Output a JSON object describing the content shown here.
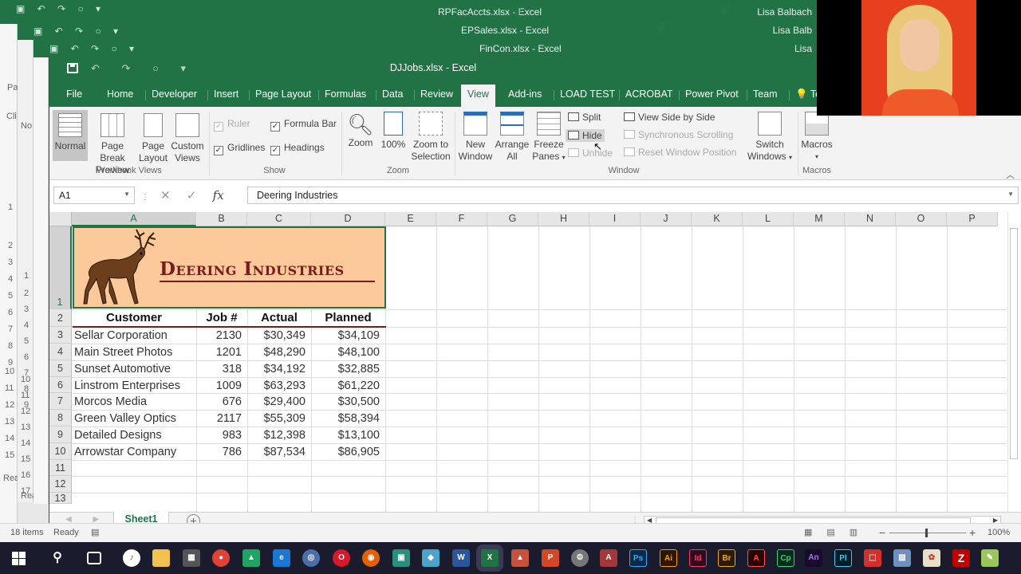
{
  "bg_windows": [
    {
      "title": "RPFacAccts.xlsx - Excel",
      "user": "Lisa Balbach"
    },
    {
      "title": "EPSales.xlsx - Excel",
      "user": "Lisa Balb"
    },
    {
      "title": "FinCon.xlsx - Excel",
      "user": "Lisa"
    }
  ],
  "slivers": {
    "a": [
      "Pa",
      "Cli",
      "1",
      "2",
      "3",
      "4",
      "5",
      "6",
      "7",
      "8",
      "9",
      "10",
      "11",
      "12",
      "13",
      "14",
      "15",
      "Rea"
    ],
    "b": [
      "No",
      "1",
      "2",
      "3",
      "4",
      "5",
      "6",
      "7",
      "8",
      "9",
      "10",
      "11",
      "12",
      "13",
      "14",
      "15",
      "16",
      "17",
      "Rea"
    ]
  },
  "window": {
    "title": "DJJobs.xlsx - Excel"
  },
  "tabs": [
    "File",
    "Home",
    "Developer",
    "Insert",
    "Page Layout",
    "Formulas",
    "Data",
    "Review",
    "View",
    "Add-ins",
    "LOAD TEST",
    "ACROBAT",
    "Power Pivot",
    "Team",
    "Te"
  ],
  "active_tab": "View",
  "ribbon": {
    "workbook_views": {
      "label": "Workbook Views",
      "normal": "Normal",
      "page_break_1": "Page Break",
      "page_break_2": "Preview",
      "page_layout_1": "Page",
      "page_layout_2": "Layout",
      "custom_1": "Custom",
      "custom_2": "Views"
    },
    "show": {
      "label": "Show",
      "ruler": "Ruler",
      "formula_bar": "Formula Bar",
      "gridlines": "Gridlines",
      "headings": "Headings"
    },
    "zoom": {
      "label": "Zoom",
      "zoom": "Zoom",
      "pct": "100%",
      "zts_1": "Zoom to",
      "zts_2": "Selection"
    },
    "window": {
      "label": "Window",
      "new_1": "New",
      "new_2": "Window",
      "arrange_1": "Arrange",
      "arrange_2": "All",
      "freeze_1": "Freeze",
      "freeze_2": "Panes",
      "split": "Split",
      "hide": "Hide",
      "unhide": "Unhide",
      "side_by_side": "View Side by Side",
      "sync": "Synchronous Scrolling",
      "reset": "Reset Window Position",
      "switch_1": "Switch",
      "switch_2": "Windows"
    },
    "macros": {
      "label": "Macros",
      "btn": "Macros"
    }
  },
  "formula_bar": {
    "namebox": "A1",
    "content": "Deering Industries"
  },
  "columns": [
    "A",
    "B",
    "C",
    "D",
    "E",
    "F",
    "G",
    "H",
    "I",
    "J",
    "K",
    "L",
    "M",
    "N",
    "O",
    "P"
  ],
  "rows": [
    "1",
    "2",
    "3",
    "4",
    "5",
    "6",
    "7",
    "8",
    "9",
    "10",
    "11",
    "12",
    "13"
  ],
  "banner": {
    "company": "Deering Industries"
  },
  "table": {
    "headers": [
      "Customer",
      "Job #",
      "Actual",
      "Planned"
    ],
    "rows": [
      [
        "Sellar Corporation",
        "2130",
        "$30,349",
        "$34,109"
      ],
      [
        "Main Street Photos",
        "1201",
        "$48,290",
        "$48,100"
      ],
      [
        "Sunset Automotive",
        "318",
        "$34,192",
        "$32,885"
      ],
      [
        "Linstrom Enterprises",
        "1009",
        "$63,293",
        "$61,220"
      ],
      [
        "Morcos Media",
        "676",
        "$29,400",
        "$30,500"
      ],
      [
        "Green Valley Optics",
        "2117",
        "$55,309",
        "$58,394"
      ],
      [
        "Detailed Designs",
        "983",
        "$12,398",
        "$13,100"
      ],
      [
        "Arrowstar Company",
        "786",
        "$87,534",
        "$86,905"
      ]
    ]
  },
  "sheet": {
    "name": "Sheet1"
  },
  "status": {
    "items": "18 items",
    "ready": "Ready",
    "zoom": "100%"
  },
  "colors": {
    "accent": "#217346",
    "banner_fill": "#fcc99a",
    "banner_text": "#7a1c1c"
  }
}
